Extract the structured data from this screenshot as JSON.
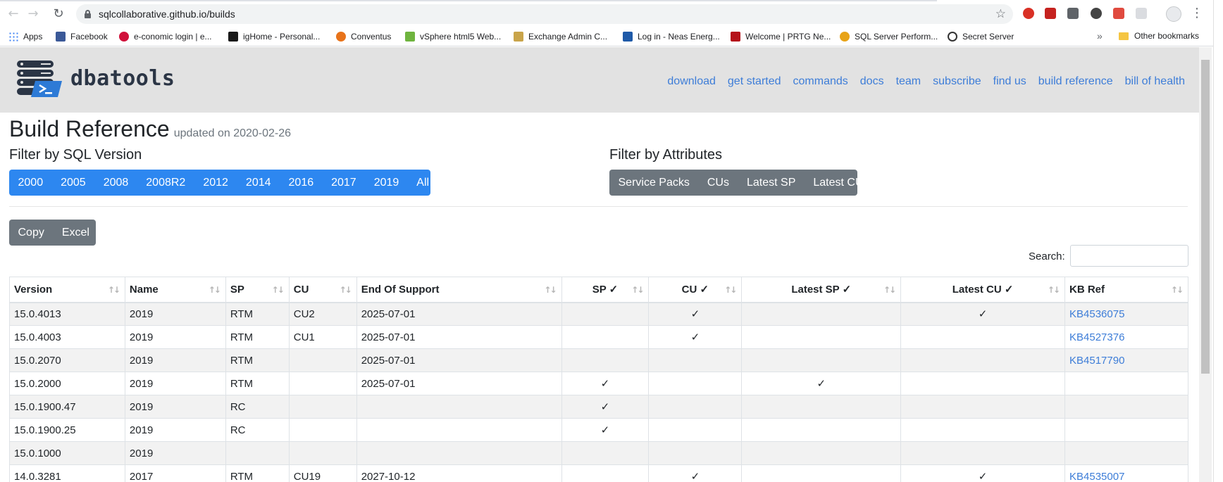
{
  "browser": {
    "url": "sqlcollaborative.github.io/builds",
    "bookmarks": [
      {
        "label": "Apps",
        "icon": "apps-grid-icon",
        "color": "#e94235"
      },
      {
        "label": "Facebook",
        "icon": "facebook-icon",
        "color": "#3b5998"
      },
      {
        "label": "e-conomic login | e...",
        "icon": "e-conomic-icon",
        "color": "#d0103a"
      },
      {
        "label": "igHome - Personal...",
        "icon": "ighome-icon",
        "color": "#1a1a1a"
      },
      {
        "label": "Conventus",
        "icon": "conventus-icon",
        "color": "#e8731a"
      },
      {
        "label": "vSphere html5 Web...",
        "icon": "vsphere-icon",
        "color": "#6fb43f"
      },
      {
        "label": "Exchange Admin C...",
        "icon": "exchange-icon",
        "color": "#c9a44a"
      },
      {
        "label": "Log in - Neas Energ...",
        "icon": "neas-icon",
        "color": "#1f5aa8"
      },
      {
        "label": "Welcome | PRTG Ne...",
        "icon": "prtg-icon",
        "color": "#b5121b"
      },
      {
        "label": "SQL Server Perform...",
        "icon": "sql-perf-icon",
        "color": "#e8a317"
      },
      {
        "label": "Secret Server",
        "icon": "secret-server-icon",
        "color": "#333333"
      }
    ],
    "more_bookmarks": "»",
    "other_bookmarks": "Other bookmarks"
  },
  "site": {
    "brand": "dbatools",
    "nav": [
      "download",
      "get started",
      "commands",
      "docs",
      "team",
      "subscribe",
      "find us",
      "build reference",
      "bill of health"
    ]
  },
  "page": {
    "title": "Build Reference",
    "updated": "updated on 2020-02-26",
    "filter_version_label": "Filter by SQL Version",
    "filter_attr_label": "Filter by Attributes",
    "versions": [
      "2000",
      "2005",
      "2008",
      "2008R2",
      "2012",
      "2014",
      "2016",
      "2017",
      "2019",
      "All"
    ],
    "attributes": [
      "Service Packs",
      "CUs",
      "Latest SP",
      "Latest CU"
    ],
    "export_buttons": [
      "Copy",
      "Excel"
    ],
    "search_label": "Search:",
    "search_value": ""
  },
  "table": {
    "columns": [
      "Version",
      "Name",
      "SP",
      "CU",
      "End Of Support",
      "SP ✓",
      "CU ✓",
      "Latest SP ✓",
      "Latest CU ✓",
      "KB Ref"
    ],
    "rows": [
      [
        "15.0.4013",
        "2019",
        "RTM",
        "CU2",
        "2025-07-01",
        "",
        "✓",
        "",
        "✓",
        "KB4536075"
      ],
      [
        "15.0.4003",
        "2019",
        "RTM",
        "CU1",
        "2025-07-01",
        "",
        "✓",
        "",
        "",
        "KB4527376"
      ],
      [
        "15.0.2070",
        "2019",
        "RTM",
        "",
        "2025-07-01",
        "",
        "",
        "",
        "",
        "KB4517790"
      ],
      [
        "15.0.2000",
        "2019",
        "RTM",
        "",
        "2025-07-01",
        "✓",
        "",
        "✓",
        "",
        ""
      ],
      [
        "15.0.1900.47",
        "2019",
        "RC",
        "",
        "",
        "✓",
        "",
        "",
        "",
        ""
      ],
      [
        "15.0.1900.25",
        "2019",
        "RC",
        "",
        "",
        "✓",
        "",
        "",
        "",
        ""
      ],
      [
        "15.0.1000",
        "2019",
        "",
        "",
        "",
        "",
        "",
        "",
        "",
        ""
      ],
      [
        "14.0.3281",
        "2017",
        "RTM",
        "CU19",
        "2027-10-12",
        "",
        "✓",
        "",
        "✓",
        "KB4535007"
      ]
    ]
  },
  "colors": {
    "primary_blue": "#2d87f0",
    "secondary_gray": "#6c757d",
    "link_blue": "#3d7dd8",
    "navbar_bg": "#e2e2e2"
  }
}
